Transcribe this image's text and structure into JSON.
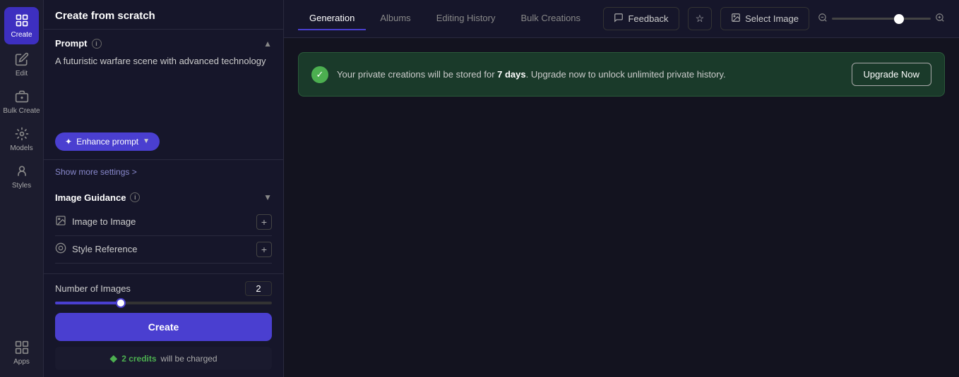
{
  "sidebar": {
    "items": [
      {
        "label": "Create",
        "icon": "create-icon",
        "active": true
      },
      {
        "label": "Edit",
        "icon": "edit-icon",
        "active": false
      },
      {
        "label": "Bulk Create",
        "icon": "bulk-create-icon",
        "active": false
      },
      {
        "label": "Models",
        "icon": "models-icon",
        "active": false
      },
      {
        "label": "Styles",
        "icon": "styles-icon",
        "active": false
      },
      {
        "label": "Apps",
        "icon": "apps-icon",
        "active": false
      }
    ]
  },
  "panel": {
    "title": "Create from scratch",
    "prompt": {
      "label": "Prompt",
      "value": "A futuristic warfare scene with advanced technology",
      "enhance_btn": "Enhance prompt"
    },
    "show_more": "Show more settings >",
    "image_guidance": {
      "label": "Image Guidance",
      "items": [
        {
          "label": "Image to Image"
        },
        {
          "label": "Style Reference"
        }
      ]
    },
    "num_images": {
      "label": "Number of Images",
      "value": "2"
    },
    "create_btn": "Create",
    "credits": {
      "amount": "2 credits",
      "suffix": "will be charged"
    }
  },
  "main": {
    "tabs": [
      {
        "label": "Generation",
        "active": true
      },
      {
        "label": "Albums",
        "active": false
      },
      {
        "label": "Editing History",
        "active": false
      },
      {
        "label": "Bulk Creations",
        "active": false
      }
    ],
    "header": {
      "feedback_btn": "Feedback",
      "select_image_btn": "Select Image"
    },
    "notice": {
      "text_before": "Your private creations will be stored for ",
      "days": "7 days",
      "text_after": ". Upgrade now to unlock unlimited private history.",
      "upgrade_btn": "Upgrade Now"
    }
  }
}
